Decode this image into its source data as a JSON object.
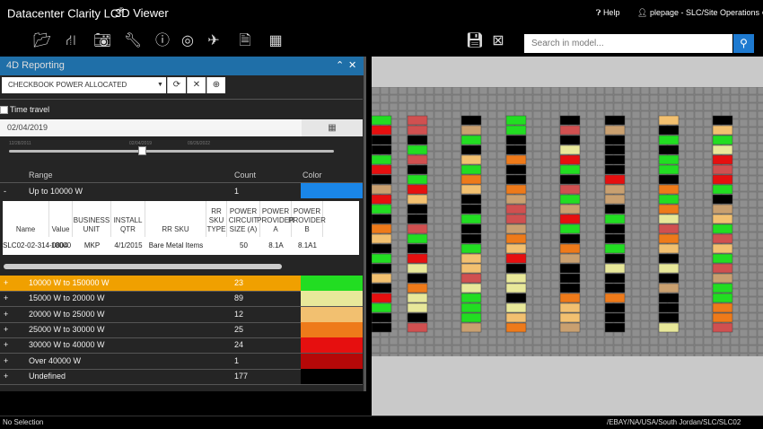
{
  "header": {
    "app_title": "Datacenter Clarity LC",
    "app_title_sup": "®",
    "viewer_title": "3D Viewer",
    "help_label": "Help",
    "user_label": "plepage - SLC/Site Operations"
  },
  "toolbar": {
    "icons": [
      "folder-icon",
      "hierarchy-icon",
      "camera-icon",
      "wrench-icon",
      "info-icon",
      "globe-icon",
      "airplane-icon",
      "document-icon",
      "calendar-icon",
      "save-view-icon",
      "clear-view-icon"
    ],
    "search_placeholder": "Search in model..."
  },
  "panel": {
    "title": "4D Reporting",
    "report_selected": "CHECKBOOK POWER ALLOCATED",
    "time_travel_label": "Time travel",
    "date_value": "02/04/2019",
    "slider_ticks": [
      "12/28/2011",
      "02/04/2019",
      "09/26/2022"
    ],
    "columns": {
      "range": "Range",
      "count": "Count",
      "color": "Color"
    },
    "expanded_row": {
      "toggle": "-",
      "range": "Up to 10000 W",
      "count": "1",
      "color": "#1a86e8"
    },
    "detail_headers": [
      "Name",
      "Value",
      "BUSINESS UNIT",
      "INSTALL QTR",
      "RR SKU",
      "RR SKU TYPE",
      "POWER CIRCUIT SIZE (A)",
      "POWER PROVIDER A",
      "POWER PROVIDER B"
    ],
    "detail_row": [
      "SLC02-02-314-0804",
      "10000",
      "MKP",
      "4/1/2015",
      "Bare Metal Items",
      "",
      "50",
      "8.1A",
      "8.1A1"
    ],
    "ranges": [
      {
        "toggle": "+",
        "range": "10000 W to 150000 W",
        "count": "23",
        "color": "#22dd22",
        "highlight": true
      },
      {
        "toggle": "+",
        "range": "15000 W to 20000 W",
        "count": "89",
        "color": "#e8e89a"
      },
      {
        "toggle": "+",
        "range": "20000 W to 25000 W",
        "count": "12",
        "color": "#f2c070"
      },
      {
        "toggle": "+",
        "range": "25000 W to 30000 W",
        "count": "25",
        "color": "#ee7a1a"
      },
      {
        "toggle": "+",
        "range": "30000 W to 40000 W",
        "count": "24",
        "color": "#e60f0f"
      },
      {
        "toggle": "+",
        "range": "Over 40000 W",
        "count": "1",
        "color": "#b50808"
      },
      {
        "toggle": "+",
        "range": "Undefined",
        "count": "177",
        "color": "#000000"
      }
    ]
  },
  "status": {
    "left": "No Selection",
    "right": "/EBAY/NA/USA/South Jordan/SLC/SLC02"
  },
  "colors": {
    "accent": "#1f6fa8",
    "highlight": "#f0a000"
  }
}
